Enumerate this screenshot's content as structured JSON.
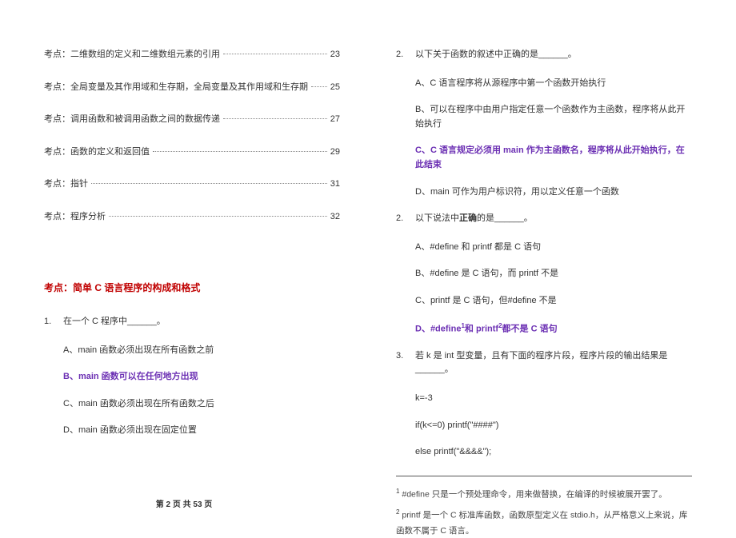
{
  "toc": [
    {
      "text": "考点：二维数组的定义和二维数组元素的引用",
      "page": "23"
    },
    {
      "text": "考点：全局变量及其作用域和生存期，全局变量及其作用域和生存期",
      "page": "25"
    },
    {
      "text": "考点：调用函数和被调用函数之间的数据传递",
      "page": "27"
    },
    {
      "text": "考点：函数的定义和返回值",
      "page": "29"
    },
    {
      "text": "考点：指针",
      "page": "31"
    },
    {
      "text": "考点：程序分析",
      "page": "32"
    }
  ],
  "heading": "考点：简单 C 语言程序的构成和格式",
  "q1": {
    "num": "1.",
    "stem": "在一个 C 程序中______。",
    "A": "A、main 函数必须出现在所有函数之前",
    "B": "B、main 函数可以在任何地方出现",
    "C": "C、main 函数必须出现在所有函数之后",
    "D": "D、main 函数必须出现在固定位置"
  },
  "q2": {
    "num": "2.",
    "stem": "以下关于函数的叙述中正确的是______。",
    "A": "A、C 语言程序将从源程序中第一个函数开始执行",
    "B": "B、可以在程序中由用户指定任意一个函数作为主函数，程序将从此开始执行",
    "C": "C、C 语言规定必须用 main 作为主函数名，程序将从此开始执行，在此结束",
    "D": "D、main 可作为用户标识符，用以定义任意一个函数"
  },
  "q3": {
    "num": "2.",
    "stem_pre": "以下说法中",
    "stem_bold": "正确",
    "stem_post": "的是______。",
    "A": "A、#define 和 printf 都是 C 语句",
    "B": "B、#define 是 C 语句，而 printf 不是",
    "C": "C、printf 是 C 语句，但#define 不是",
    "D_pre": "D、#define",
    "D_sup1": "1",
    "D_mid": "和 printf",
    "D_sup2": "2",
    "D_post": "都不是 C 语句"
  },
  "q4": {
    "num": "3.",
    "stem": "若 k 是 int 型变量，且有下面的程序片段，程序片段的输出结果是______。",
    "line1": "k=-3",
    "line2": "if(k<=0) printf(\"####\")",
    "line3": "else printf(\"&&&&\");"
  },
  "footnotes": {
    "f1_sup": "1",
    "f1": " #define 只是一个预处理命令，用来做替换，在编译的时候被展开罢了。",
    "f2_sup": "2",
    "f2": " printf 是一个 C 标准库函数，函数原型定义在 stdio.h，从严格意义上来说，库函数不属于 C 语言。"
  },
  "footer": {
    "prefix": "第 ",
    "cur": "2",
    "mid": " 页 共 ",
    "total": "53",
    "suffix": " 页"
  }
}
